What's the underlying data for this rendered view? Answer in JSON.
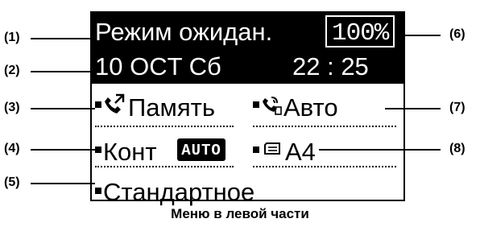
{
  "display": {
    "mode": "Режим ожидан.",
    "date": "10 OCT  Сб",
    "time": "22 : 25",
    "zoom": "100%",
    "memory": "Память",
    "auto": "Авто",
    "contrast": "Конт",
    "contrast_badge": "AUTO",
    "paper": "A4",
    "resolution": "Стандартное"
  },
  "callouts": {
    "c1": "(1)",
    "c2": "(2)",
    "c3": "(3)",
    "c4": "(4)",
    "c5": "(5)",
    "c6": "(6)",
    "c7": "(7)",
    "c8": "(8)"
  },
  "caption": "Меню в левой части",
  "icons": [
    "phone-memory-icon",
    "fax-auto-icon",
    "paper-tray-icon"
  ]
}
